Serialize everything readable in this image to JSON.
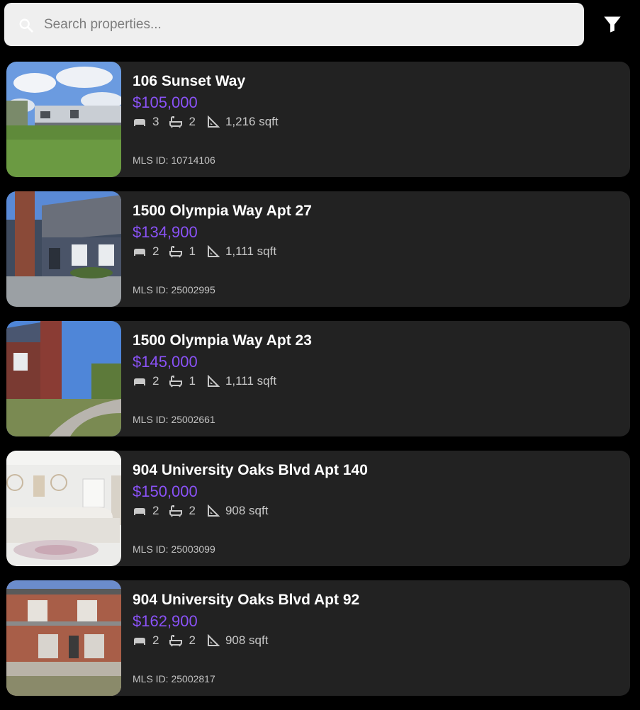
{
  "search": {
    "placeholder": "Search properties..."
  },
  "colors": {
    "price": "#8a52f7",
    "card": "#222222",
    "background": "#000000"
  },
  "listings": [
    {
      "address": "106 Sunset Way",
      "price": "$105,000",
      "beds": "3",
      "baths": "2",
      "sqft": "1,216 sqft",
      "mls": "MLS ID: 10714106"
    },
    {
      "address": "1500 Olympia Way Apt 27",
      "price": "$134,900",
      "beds": "2",
      "baths": "1",
      "sqft": "1,111 sqft",
      "mls": "MLS ID: 25002995"
    },
    {
      "address": "1500 Olympia Way Apt 23",
      "price": "$145,000",
      "beds": "2",
      "baths": "1",
      "sqft": "1,111 sqft",
      "mls": "MLS ID: 25002661"
    },
    {
      "address": "904 University Oaks Blvd Apt 140",
      "price": "$150,000",
      "beds": "2",
      "baths": "2",
      "sqft": "908 sqft",
      "mls": "MLS ID: 25003099"
    },
    {
      "address": "904 University Oaks Blvd Apt 92",
      "price": "$162,900",
      "beds": "2",
      "baths": "2",
      "sqft": "908 sqft",
      "mls": "MLS ID: 25002817"
    }
  ]
}
